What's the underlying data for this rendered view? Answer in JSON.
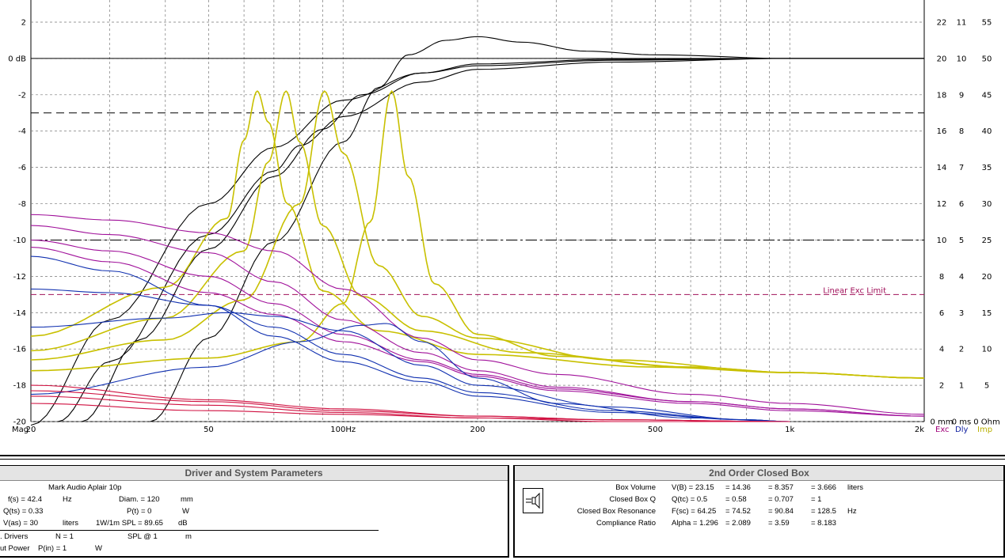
{
  "chart_data": {
    "type": "line",
    "x_scale": "log",
    "xlim": [
      20,
      2000
    ],
    "ylim": [
      -20,
      2
    ],
    "x_ticks": [
      {
        "value": 20,
        "label": "20"
      },
      {
        "value": 50,
        "label": "50"
      },
      {
        "value": 100,
        "label": "100Hz"
      },
      {
        "value": 200,
        "label": "200"
      },
      {
        "value": 500,
        "label": "500"
      },
      {
        "value": 1000,
        "label": "1k"
      },
      {
        "value": 2000,
        "label": "2k"
      }
    ],
    "x_axis_prefix": "Mag",
    "y_ticks": [
      {
        "value": 2,
        "label": "2"
      },
      {
        "value": 0,
        "label": "0 dB"
      },
      {
        "value": -2,
        "label": "-2"
      },
      {
        "value": -4,
        "label": "-4"
      },
      {
        "value": -6,
        "label": "-6"
      },
      {
        "value": -8,
        "label": "-8"
      },
      {
        "value": -10,
        "label": "-10"
      },
      {
        "value": -12,
        "label": "-12"
      },
      {
        "value": -14,
        "label": "-14"
      },
      {
        "value": -16,
        "label": "-16"
      },
      {
        "value": -18,
        "label": "-18"
      },
      {
        "value": -20,
        "label": "-20"
      }
    ],
    "right_axes": [
      {
        "labels": [
          "22",
          "20",
          "18",
          "16",
          "14",
          "12",
          "10",
          "8",
          "6",
          "4",
          "2",
          "0 mm"
        ],
        "footer": "Exc",
        "color": "#a0007a"
      },
      {
        "labels": [
          "11",
          "10",
          "9",
          "8",
          "7",
          "6",
          "5",
          "4",
          "3",
          "2",
          "1",
          "0 ms"
        ],
        "footer": "Dly",
        "color": "#1020a0"
      },
      {
        "labels": [
          "55",
          "50",
          "45",
          "40",
          "35",
          "30",
          "25",
          "20",
          "15",
          "10",
          "5",
          "0 Ohm"
        ],
        "footer": "Imp",
        "color": "#b8b000"
      }
    ],
    "annotation": {
      "text": "Linear Exc Limit",
      "y": -13,
      "color": "#a0105a"
    },
    "reference_lines": [
      {
        "y": 0,
        "style": "solid"
      },
      {
        "y": -3,
        "style": "dashed"
      },
      {
        "y": -10,
        "style": "dashdot"
      },
      {
        "y": -13,
        "style": "dashed",
        "color": "#a0105a"
      }
    ],
    "grid": true,
    "grid_freqs": [
      30,
      40,
      60,
      70,
      80,
      90,
      300,
      400,
      600,
      700,
      800,
      900
    ],
    "systems": [
      {
        "fsc": 64.25,
        "qtc": 0.5
      },
      {
        "fsc": 74.52,
        "qtc": 0.58
      },
      {
        "fsc": 90.84,
        "qtc": 0.707
      },
      {
        "fsc": 128.5,
        "qtc": 1
      }
    ],
    "series": [
      {
        "kind": "magnitude",
        "color": "#000000",
        "points": [
          [
            20,
            -20.2
          ],
          [
            30,
            -14.4
          ],
          [
            50,
            -8.0
          ],
          [
            70,
            -4.9
          ],
          [
            100,
            -2.3
          ],
          [
            150,
            -0.8
          ],
          [
            200,
            -0.4
          ],
          [
            400,
            -0.1
          ],
          [
            1000,
            0
          ],
          [
            2000,
            0
          ]
        ]
      },
      {
        "kind": "magnitude",
        "color": "#000000",
        "points": [
          [
            23,
            -20.0
          ],
          [
            30,
            -16.7
          ],
          [
            50,
            -9.7
          ],
          [
            70,
            -6.2
          ],
          [
            80,
            -4.8
          ],
          [
            100,
            -3.2
          ],
          [
            150,
            -1.3
          ],
          [
            200,
            -0.6
          ],
          [
            400,
            -0.2
          ],
          [
            1000,
            0
          ],
          [
            2000,
            0
          ]
        ]
      },
      {
        "kind": "magnitude",
        "color": "#000000",
        "points": [
          [
            26,
            -20.0
          ],
          [
            35,
            -15.5
          ],
          [
            50,
            -10.5
          ],
          [
            70,
            -6.5
          ],
          [
            90,
            -3.9
          ],
          [
            110,
            -2.0
          ],
          [
            150,
            -0.8
          ],
          [
            200,
            -0.3
          ],
          [
            400,
            -0.05
          ],
          [
            1000,
            0
          ],
          [
            2000,
            0
          ]
        ]
      },
      {
        "kind": "magnitude",
        "color": "#000000",
        "points": [
          [
            37,
            -20.0
          ],
          [
            50,
            -15.4
          ],
          [
            70,
            -10.1
          ],
          [
            100,
            -4.6
          ],
          [
            120,
            -1.6
          ],
          [
            140,
            0.2
          ],
          [
            170,
            1.0
          ],
          [
            200,
            1.2
          ],
          [
            250,
            0.9
          ],
          [
            350,
            0.4
          ],
          [
            500,
            0.2
          ],
          [
            1000,
            0
          ],
          [
            2000,
            0
          ]
        ]
      },
      {
        "kind": "impedance",
        "color": "#c8c000",
        "points": [
          [
            20,
            -15.3
          ],
          [
            40,
            -12.6
          ],
          [
            55,
            -8.8
          ],
          [
            60,
            -4.5
          ],
          [
            64.25,
            -1.8
          ],
          [
            68,
            -3.5
          ],
          [
            75,
            -8.0
          ],
          [
            90,
            -12.8
          ],
          [
            120,
            -15.0
          ],
          [
            200,
            -16.3
          ],
          [
            500,
            -17.0
          ],
          [
            1000,
            -17.3
          ],
          [
            2000,
            -17.6
          ]
        ]
      },
      {
        "kind": "impedance",
        "color": "#c8c000",
        "points": [
          [
            20,
            -16.1
          ],
          [
            40,
            -14.3
          ],
          [
            60,
            -10.6
          ],
          [
            68,
            -5.7
          ],
          [
            74.52,
            -1.8
          ],
          [
            80,
            -4.6
          ],
          [
            90,
            -9.2
          ],
          [
            110,
            -13.1
          ],
          [
            150,
            -15.0
          ],
          [
            250,
            -16.2
          ],
          [
            600,
            -17.0
          ],
          [
            1000,
            -17.3
          ],
          [
            2000,
            -17.6
          ]
        ]
      },
      {
        "kind": "impedance",
        "color": "#c8c000",
        "points": [
          [
            20,
            -16.6
          ],
          [
            40,
            -15.5
          ],
          [
            60,
            -13.3
          ],
          [
            80,
            -8.0
          ],
          [
            90.84,
            -1.8
          ],
          [
            100,
            -5.2
          ],
          [
            120,
            -11.4
          ],
          [
            150,
            -14.2
          ],
          [
            200,
            -15.4
          ],
          [
            400,
            -16.6
          ],
          [
            1000,
            -17.3
          ],
          [
            2000,
            -17.6
          ]
        ]
      },
      {
        "kind": "impedance",
        "color": "#c8c000",
        "points": [
          [
            20,
            -17.2
          ],
          [
            50,
            -16.5
          ],
          [
            80,
            -15.6
          ],
          [
            100,
            -13.5
          ],
          [
            115,
            -9.0
          ],
          [
            128.5,
            -1.8
          ],
          [
            140,
            -6.5
          ],
          [
            160,
            -12.4
          ],
          [
            200,
            -15.2
          ],
          [
            300,
            -16.4
          ],
          [
            600,
            -17.0
          ],
          [
            1000,
            -17.3
          ],
          [
            2000,
            -17.6
          ]
        ]
      },
      {
        "kind": "excursion",
        "color": "#a0109a",
        "points": [
          [
            20,
            -8.6
          ],
          [
            30,
            -8.9
          ],
          [
            50,
            -9.6
          ],
          [
            70,
            -10.6
          ],
          [
            100,
            -12.7
          ],
          [
            150,
            -15.4
          ],
          [
            200,
            -16.6
          ],
          [
            300,
            -17.4
          ],
          [
            600,
            -18.5
          ],
          [
            1000,
            -19.0
          ],
          [
            2000,
            -19.6
          ]
        ]
      },
      {
        "kind": "excursion",
        "color": "#a0109a",
        "points": [
          [
            20,
            -9.2
          ],
          [
            30,
            -9.7
          ],
          [
            50,
            -10.7
          ],
          [
            70,
            -12.3
          ],
          [
            100,
            -14.4
          ],
          [
            150,
            -16.2
          ],
          [
            200,
            -17.2
          ],
          [
            300,
            -18.1
          ],
          [
            600,
            -18.9
          ],
          [
            1000,
            -19.3
          ],
          [
            2000,
            -19.7
          ]
        ]
      },
      {
        "kind": "excursion",
        "color": "#a0109a",
        "points": [
          [
            20,
            -10.0
          ],
          [
            30,
            -10.6
          ],
          [
            50,
            -12.0
          ],
          [
            70,
            -13.5
          ],
          [
            100,
            -15.2
          ],
          [
            150,
            -16.6
          ],
          [
            200,
            -17.4
          ],
          [
            300,
            -18.2
          ],
          [
            600,
            -18.9
          ],
          [
            1000,
            -19.3
          ],
          [
            2000,
            -19.7
          ]
        ]
      },
      {
        "kind": "excursion",
        "color": "#a0109a",
        "points": [
          [
            20,
            -10.4
          ],
          [
            30,
            -11.2
          ],
          [
            50,
            -12.9
          ],
          [
            70,
            -14.1
          ],
          [
            100,
            -15.6
          ],
          [
            150,
            -16.7
          ],
          [
            200,
            -17.5
          ],
          [
            300,
            -18.3
          ],
          [
            600,
            -19.0
          ],
          [
            1000,
            -19.4
          ],
          [
            2000,
            -19.7
          ]
        ]
      },
      {
        "kind": "delay",
        "color": "#1030b0",
        "points": [
          [
            20,
            -10.9
          ],
          [
            30,
            -11.7
          ],
          [
            50,
            -13.6
          ],
          [
            70,
            -15.3
          ],
          [
            100,
            -16.7
          ],
          [
            150,
            -17.8
          ],
          [
            200,
            -18.6
          ],
          [
            400,
            -19.5
          ],
          [
            800,
            -19.9
          ],
          [
            1000,
            -20.0
          ]
        ]
      },
      {
        "kind": "delay",
        "color": "#1030b0",
        "points": [
          [
            20,
            -12.7
          ],
          [
            30,
            -12.9
          ],
          [
            50,
            -13.6
          ],
          [
            70,
            -14.8
          ],
          [
            100,
            -16.3
          ],
          [
            150,
            -17.6
          ],
          [
            200,
            -18.4
          ],
          [
            400,
            -19.4
          ],
          [
            800,
            -19.9
          ],
          [
            1000,
            -20.0
          ]
        ]
      },
      {
        "kind": "delay",
        "color": "#1030b0",
        "points": [
          [
            20,
            -14.8
          ],
          [
            40,
            -14.3
          ],
          [
            55,
            -14.0
          ],
          [
            70,
            -14.2
          ],
          [
            100,
            -15.0
          ],
          [
            150,
            -16.9
          ],
          [
            200,
            -18.0
          ],
          [
            400,
            -19.2
          ],
          [
            800,
            -19.9
          ],
          [
            1000,
            -20.0
          ]
        ]
      },
      {
        "kind": "delay",
        "color": "#1030b0",
        "points": [
          [
            20,
            -18.5
          ],
          [
            50,
            -17.0
          ],
          [
            80,
            -15.6
          ],
          [
            110,
            -14.7
          ],
          [
            125,
            -14.6
          ],
          [
            150,
            -15.6
          ],
          [
            200,
            -17.6
          ],
          [
            300,
            -19.0
          ],
          [
            600,
            -19.8
          ],
          [
            1000,
            -20.0
          ]
        ]
      },
      {
        "kind": "power",
        "color": "#d01040",
        "points": [
          [
            20,
            -18.0
          ],
          [
            50,
            -18.8
          ],
          [
            100,
            -19.3
          ],
          [
            200,
            -19.7
          ],
          [
            400,
            -19.9
          ],
          [
            1000,
            -20.0
          ]
        ]
      },
      {
        "kind": "power",
        "color": "#d01040",
        "points": [
          [
            20,
            -18.3
          ],
          [
            50,
            -18.9
          ],
          [
            100,
            -19.4
          ],
          [
            200,
            -19.7
          ],
          [
            400,
            -19.9
          ],
          [
            1000,
            -20.0
          ]
        ]
      },
      {
        "kind": "power",
        "color": "#d01040",
        "points": [
          [
            20,
            -18.6
          ],
          [
            50,
            -19.1
          ],
          [
            100,
            -19.5
          ],
          [
            200,
            -19.8
          ],
          [
            400,
            -19.9
          ],
          [
            1000,
            -20.0
          ]
        ]
      },
      {
        "kind": "power",
        "color": "#d01040",
        "points": [
          [
            20,
            -19.0
          ],
          [
            50,
            -19.4
          ],
          [
            100,
            -19.6
          ],
          [
            200,
            -19.8
          ],
          [
            400,
            -20.0
          ],
          [
            1000,
            -20.0
          ]
        ]
      }
    ]
  },
  "driver_panel": {
    "title": "Driver and System Parameters",
    "driver_name": "Mark Audio  Aplair 10p",
    "fs_label": "f(s) = 42.4",
    "fs_unit": "Hz",
    "diam_label": "Diam. = 120",
    "diam_unit": "mm",
    "qts_label": "Q(ts) = 0.33",
    "pt_label": "P(t) = 0",
    "pt_unit": "W",
    "vas_label": "V(as) = 30",
    "vas_unit": "liters",
    "spl_label": "1W/1m SPL = 89.65",
    "spl_unit": "dB",
    "drivers_label": ". Drivers",
    "drivers_value": "N = 1",
    "splat_label": "SPL @ 1",
    "splat_unit": "m",
    "power_label": "ut Power",
    "power_value": "P(in) = 1",
    "power_unit": "W"
  },
  "box_panel": {
    "title": "2nd Order Closed Box",
    "rows": [
      {
        "label": "Box Volume",
        "v1": "V(B) = 23.15",
        "v2": "= 14.36",
        "v3": "= 8.357",
        "v4": "= 3.666",
        "unit": "liters"
      },
      {
        "label": "Closed Box Q",
        "v1": "Q(tc) = 0.5",
        "v2": "= 0.58",
        "v3": "= 0.707",
        "v4": "= 1",
        "unit": ""
      },
      {
        "label": "Closed Box Resonance",
        "v1": "F(sc) = 64.25",
        "v2": "= 74.52",
        "v3": "= 90.84",
        "v4": "= 128.5",
        "unit": "Hz"
      },
      {
        "label": "Compliance Ratio",
        "v1": "Alpha = 1.296",
        "v2": "= 2.089",
        "v3": "= 3.59",
        "v4": "= 8.183",
        "unit": ""
      }
    ]
  }
}
